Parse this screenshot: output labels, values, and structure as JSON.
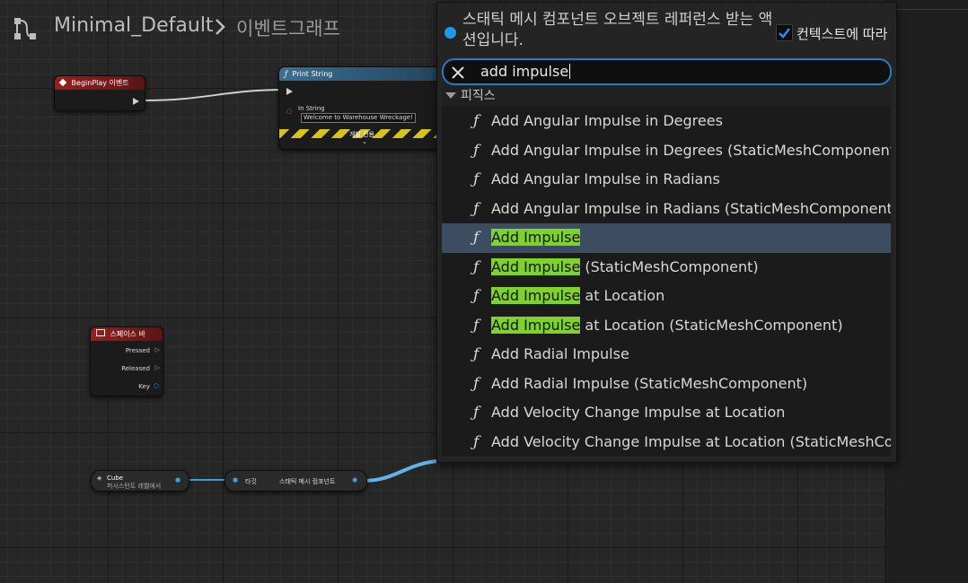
{
  "header": {
    "graph_name": "Minimal_Default",
    "sub_name": "이벤트그래프"
  },
  "nodes": {
    "begin_play": {
      "title": "BeginPlay 이벤트",
      "color": "#8b1a1a"
    },
    "print_string": {
      "title": "Print String",
      "in_string_label": "In String",
      "in_string_value": "Welcome to Warehouse Wreckage!",
      "dev_only": "개발 전용",
      "color": "#2e5a7a"
    },
    "space_bar": {
      "title": "스페이스 바",
      "pins": [
        "Pressed",
        "Released",
        "Key"
      ],
      "color": "#8b1a1a"
    },
    "cube": {
      "title": "Cube",
      "subtitle": "퍼시스턴트 레벨에서"
    },
    "get_component": {
      "left_label": "타깃",
      "right_label": "스태틱 메시 컴포넌트"
    }
  },
  "popup": {
    "context_title": "스태틱 메시 컴포넌트 오브젝트 레퍼런스 받는 액션입니다.",
    "context_checkbox_label": "컨텍스트에 따라",
    "context_checked": true,
    "search_value": "add impulse",
    "category": "피직스",
    "items": [
      {
        "pre": "",
        "hl": "",
        "post": "Add Angular Impulse in Degrees"
      },
      {
        "pre": "",
        "hl": "",
        "post": "Add Angular Impulse in Degrees (StaticMeshComponent)"
      },
      {
        "pre": "",
        "hl": "",
        "post": "Add Angular Impulse in Radians"
      },
      {
        "pre": "",
        "hl": "",
        "post": "Add Angular Impulse in Radians (StaticMeshComponent)"
      },
      {
        "pre": "",
        "hl": "Add Impulse",
        "post": "",
        "selected": true
      },
      {
        "pre": "",
        "hl": "Add Impulse",
        "post": " (StaticMeshComponent)"
      },
      {
        "pre": "",
        "hl": "Add Impulse",
        "post": " at Location"
      },
      {
        "pre": "",
        "hl": "Add Impulse",
        "post": " at Location (StaticMeshComponent)"
      },
      {
        "pre": "",
        "hl": "",
        "post": "Add Radial Impulse"
      },
      {
        "pre": "",
        "hl": "",
        "post": "Add Radial Impulse (StaticMeshComponent)"
      },
      {
        "pre": "",
        "hl": "",
        "post": "Add Velocity Change Impulse at Location"
      },
      {
        "pre": "",
        "hl": "",
        "post": "Add Velocity Change Impulse at Location (StaticMeshComponent)"
      }
    ]
  }
}
